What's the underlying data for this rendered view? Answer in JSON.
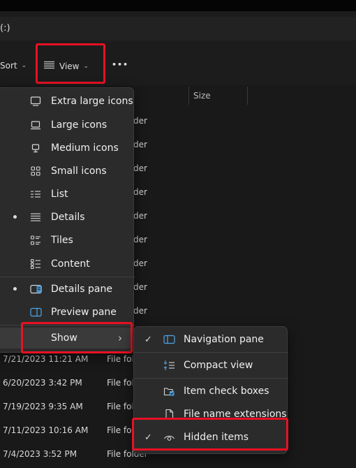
{
  "address": {
    "text": "(:)"
  },
  "toolbar": {
    "sort_label": "Sort",
    "view_label": "View",
    "more_label": "•••"
  },
  "columns": {
    "size": "Size"
  },
  "partial_type_text": "der",
  "rows": [
    {
      "date": "7/21/2023 11:21 AM",
      "type": "File folder"
    },
    {
      "date": "6/20/2023 3:42 PM",
      "type": "File folder"
    },
    {
      "date": "7/19/2023 9:35 AM",
      "type": "File folder"
    },
    {
      "date": "7/11/2023 10:16 AM",
      "type": "File folder"
    },
    {
      "date": "7/4/2023 3:52 PM",
      "type": "File folder"
    }
  ],
  "view_menu": {
    "items": [
      {
        "label": "Extra large icons",
        "icon": "monitor-icon",
        "selected": false
      },
      {
        "label": "Large icons",
        "icon": "laptop-icon",
        "selected": false
      },
      {
        "label": "Medium icons",
        "icon": "desktop-icon",
        "selected": false
      },
      {
        "label": "Small icons",
        "icon": "grid-icon",
        "selected": false
      },
      {
        "label": "List",
        "icon": "list-icon",
        "selected": false
      },
      {
        "label": "Details",
        "icon": "details-icon",
        "selected": true
      },
      {
        "label": "Tiles",
        "icon": "tiles-icon",
        "selected": false
      },
      {
        "label": "Content",
        "icon": "content-icon",
        "selected": false
      },
      {
        "label": "Details pane",
        "icon": "details-pane-icon",
        "selected": true
      },
      {
        "label": "Preview pane",
        "icon": "preview-pane-icon",
        "selected": false
      }
    ],
    "show_label": "Show",
    "show_chevron": "›"
  },
  "show_menu": {
    "items": [
      {
        "label": "Navigation pane",
        "icon": "navigation-pane-icon",
        "checked": true
      },
      {
        "label": "Compact view",
        "icon": "compact-view-icon",
        "checked": false
      },
      {
        "label": "Item check boxes",
        "icon": "checkbox-icon",
        "checked": false
      },
      {
        "label": "File name extensions",
        "icon": "file-icon",
        "checked": false
      },
      {
        "label": "Hidden items",
        "icon": "eye-icon",
        "checked": true
      }
    ],
    "check_glyph": "✓"
  },
  "colors": {
    "highlight": "#e81123",
    "accent": "#4ea5e6",
    "menu_bg": "#2b2b2b"
  }
}
